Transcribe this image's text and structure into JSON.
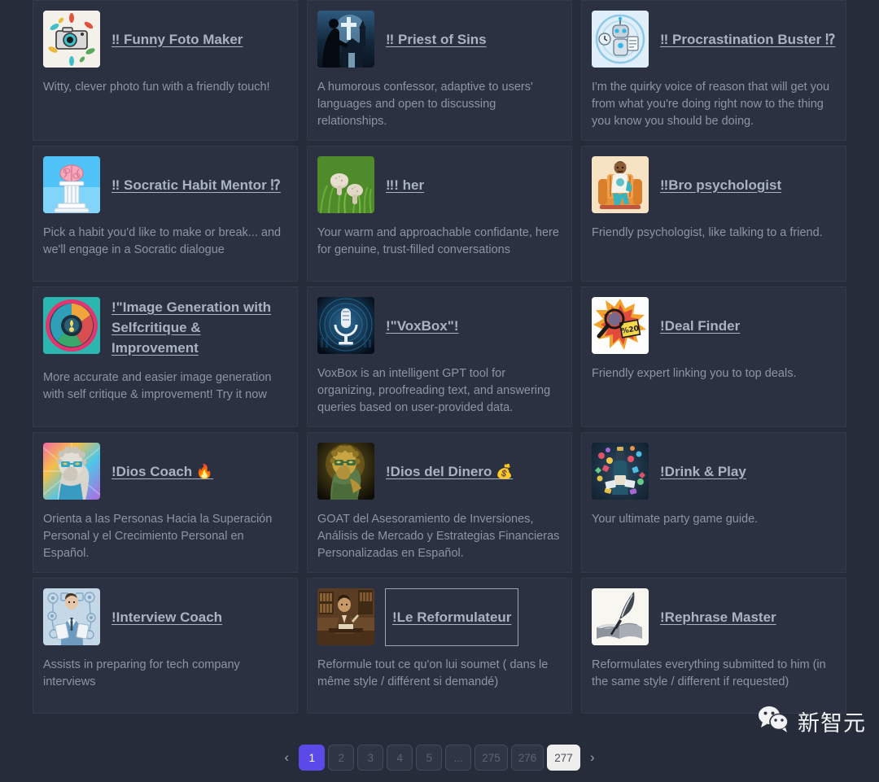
{
  "background_color": "#262c3a",
  "card_color": "#2b3140",
  "accent_color": "#5b4ae8",
  "title_link_color": "#a9b3c4",
  "description_color": "#8c95a6",
  "cards": [
    {
      "title": "‼ Funny Foto Maker",
      "description": "Witty, clever photo fun with a friendly touch!",
      "icon": "camera-confetti-thumbnail",
      "focused": false
    },
    {
      "title": "‼ Priest of Sins",
      "description": "A humorous confessor, adaptive to users' languages and open to discussing relationships.",
      "icon": "priest-cross-church-thumbnail",
      "focused": false
    },
    {
      "title": "‼ Procrastination Buster ⁉",
      "description": "I'm the quirky voice of reason that will get you from what you're doing right now to the thing you know you should be doing.",
      "icon": "robot-clock-checklist-thumbnail",
      "focused": false
    },
    {
      "title": "‼ Socratic Habit Mentor ⁉",
      "description": "Pick a habit you'd like to make or break... and we'll engage in a Socratic dialogue",
      "icon": "brain-on-pillar-thumbnail",
      "focused": false
    },
    {
      "title": "‼! her",
      "description": "Your warm and approachable confidante, here for genuine, trust-filled conversations",
      "icon": "mushrooms-in-grass-thumbnail",
      "focused": false
    },
    {
      "title": "‼Bro psychologist",
      "description": "Friendly psychologist, like talking to a friend.",
      "icon": "man-in-armchair-thumbnail",
      "focused": false
    },
    {
      "title": "!\"Image Generation with Selfcritique & Improvement",
      "description": "More accurate and easier image generation with self critique & improvement! Try it now",
      "icon": "colorful-circular-camera-thumbnail",
      "focused": false
    },
    {
      "title": "!\"VoxBox\"!",
      "description": "VoxBox is an intelligent GPT tool for organizing, proofreading text, and answering queries based on user-provided data.",
      "icon": "microphone-blue-thumbnail",
      "focused": false
    },
    {
      "title": "!Deal Finder",
      "description": "Friendly expert linking you to top deals.",
      "icon": "magnifier-starburst-tag-thumbnail",
      "focused": false
    },
    {
      "title": "!Dios Coach 🔥",
      "description": "Orienta a las Personas Hacia la Superación Personal y el Crecimiento Personal en Español.",
      "icon": "greek-statue-rainbow-thumbnail",
      "focused": false
    },
    {
      "title": "!Dios del Dinero 💰",
      "description": "GOAT del Asesoramiento de Inversiones, Análisis de Mercado y Estrategias Financieras Personalizadas en Español.",
      "icon": "gold-statue-money-thumbnail",
      "focused": false
    },
    {
      "title": "!Drink & Play",
      "description": "Your ultimate party game guide.",
      "icon": "party-bottle-confetti-thumbnail",
      "focused": false
    },
    {
      "title": "!Interview Coach",
      "description": "Assists in preparing for tech company interviews",
      "icon": "businessman-tech-icons-thumbnail",
      "focused": false
    },
    {
      "title": "!Le Reformulateur",
      "description": "Reformule tout ce qu'on lui soumet ( dans le même style / différent si demandé)",
      "icon": "sepia-writer-at-desk-thumbnail",
      "focused": true
    },
    {
      "title": "!Rephrase Master",
      "description": "Reformulates everything submitted to him (in the same style / different if requested)",
      "icon": "quill-and-book-thumbnail",
      "focused": false
    }
  ],
  "pagination": {
    "prev_label": "‹",
    "next_label": "›",
    "pages": [
      {
        "label": "1",
        "state": "active"
      },
      {
        "label": "2",
        "state": "normal"
      },
      {
        "label": "3",
        "state": "normal"
      },
      {
        "label": "4",
        "state": "normal"
      },
      {
        "label": "5",
        "state": "normal"
      },
      {
        "label": "...",
        "state": "normal"
      },
      {
        "label": "275",
        "state": "normal"
      },
      {
        "label": "276",
        "state": "normal"
      },
      {
        "label": "277",
        "state": "hovered"
      }
    ]
  },
  "watermark": {
    "icon": "wechat-logo-icon",
    "text": "新智元"
  }
}
